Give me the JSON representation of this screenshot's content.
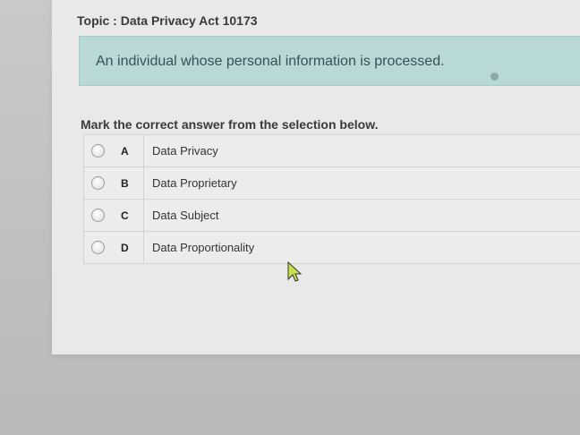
{
  "topic": "Topic : Data Privacy Act 10173",
  "question": "An individual whose personal information is processed.",
  "instruction": "Mark the correct answer from the selection below.",
  "options": [
    {
      "letter": "A",
      "text": "Data Privacy"
    },
    {
      "letter": "B",
      "text": "Data Proprietary"
    },
    {
      "letter": "C",
      "text": "Data Subject"
    },
    {
      "letter": "D",
      "text": "Data Proportionality"
    }
  ],
  "colors": {
    "question_bg": "#b9d9d6",
    "page_bg": "#e9e9e9"
  },
  "icons": {
    "radio": "radio-circle",
    "cursor": "arrow-cursor"
  }
}
